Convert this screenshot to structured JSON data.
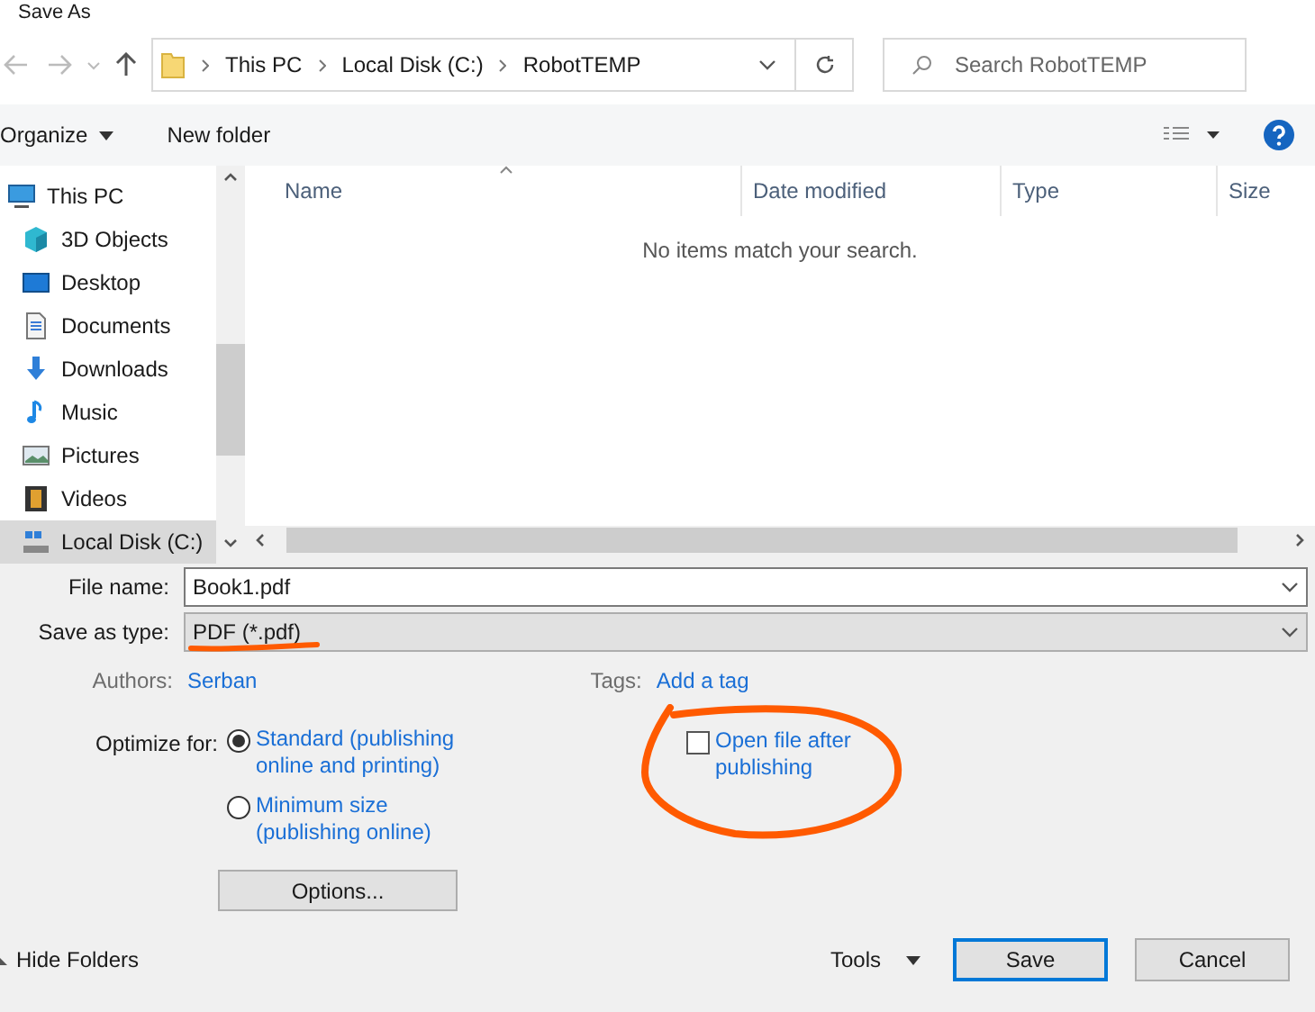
{
  "window": {
    "title": "Save As"
  },
  "address": {
    "path": [
      "This PC",
      "Local Disk (C:)",
      "RobotTEMP"
    ]
  },
  "search": {
    "placeholder": "Search RobotTEMP"
  },
  "toolbar": {
    "organize": "Organize",
    "new_folder": "New folder"
  },
  "sidebar": {
    "items": [
      {
        "label": "This PC",
        "kind": "pc",
        "selected": false
      },
      {
        "label": "3D Objects",
        "kind": "cube",
        "selected": false
      },
      {
        "label": "Desktop",
        "kind": "desktop",
        "selected": false
      },
      {
        "label": "Documents",
        "kind": "document",
        "selected": false
      },
      {
        "label": "Downloads",
        "kind": "download",
        "selected": false
      },
      {
        "label": "Music",
        "kind": "music",
        "selected": false
      },
      {
        "label": "Pictures",
        "kind": "pictures",
        "selected": false
      },
      {
        "label": "Videos",
        "kind": "videos",
        "selected": false
      },
      {
        "label": "Local Disk (C:)",
        "kind": "disk",
        "selected": true
      }
    ]
  },
  "table": {
    "columns": [
      "Name",
      "Date modified",
      "Type",
      "Size"
    ],
    "empty_message": "No items match your search."
  },
  "file_name": {
    "label": "File name:",
    "value": "Book1.pdf"
  },
  "save_as_type": {
    "label": "Save as type:",
    "value": "PDF (*.pdf)"
  },
  "authors": {
    "label": "Authors:",
    "value": "Serban"
  },
  "tags": {
    "label": "Tags:",
    "value": "Add a tag"
  },
  "optimize": {
    "label": "Optimize for:",
    "options": [
      {
        "label": "Standard (publishing online and printing)",
        "selected": true
      },
      {
        "label": "Minimum size (publishing online)",
        "selected": false
      }
    ]
  },
  "open_after": {
    "label": "Open file after publishing",
    "checked": false
  },
  "options_button": "Options...",
  "hide_folders": "Hide Folders",
  "tools": "Tools",
  "save": "Save",
  "cancel": "Cancel"
}
